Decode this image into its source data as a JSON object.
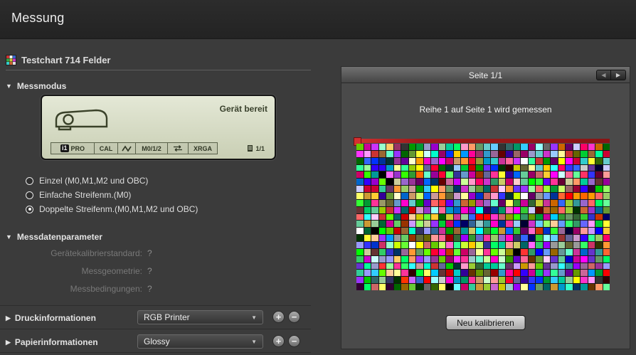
{
  "header": {
    "title": "Messung"
  },
  "left_panel": {
    "testchart_title": "Testchart 714 Felder",
    "messmodus": {
      "label": "Messmodus"
    },
    "device_display": {
      "status": "Gerät bereit",
      "i1_badge": "i1",
      "pro_label": "PRO",
      "cal_label": "CAL",
      "m012_label": "M0/1/2",
      "xrga_label": "XRGA",
      "page_label": "1/1"
    },
    "radios": [
      {
        "label": "Einzel (M0,M1,M2 und OBC)",
        "selected": false
      },
      {
        "label": "Einfache Streifenm.(M0)",
        "selected": false
      },
      {
        "label": "Doppelte Streifenm.(M0,M1,M2 und OBC)",
        "selected": true
      }
    ],
    "messdatenparameter": {
      "label": "Messdatenparameter",
      "params": [
        {
          "label": "Gerätekalibrierstandard:",
          "value": "?"
        },
        {
          "label": "Messgeometrie:",
          "value": "?"
        },
        {
          "label": "Messbedingungen:",
          "value": "?"
        }
      ]
    },
    "druckinformationen": {
      "label": "Druckinformationen",
      "selected_value": "RGB Printer"
    },
    "papierinformationen": {
      "label": "Papierinformationen",
      "selected_value": "Glossy"
    }
  },
  "preview_panel": {
    "page_label": "Seite 1/1",
    "status_text": "Reihe 1 auf Seite 1 wird gemessen",
    "recalibrate_label": "Neu kalibrieren",
    "chart": {
      "rows": 21,
      "cols": 34,
      "total_patches": 714,
      "seed": 714
    }
  },
  "icons": {
    "chevron_down": "▼",
    "chevron_right": "▶",
    "nav_prev": "◀",
    "nav_next": "▶",
    "dropdown_arrow": "▼",
    "plus": "+",
    "minus": "−"
  },
  "colors": {
    "topbar_background": "#262626",
    "page_background": "#3b3b3b",
    "panel_background": "#4a4a4a",
    "lcd_background": "#d9deca",
    "ruler_red": "#b22222"
  }
}
